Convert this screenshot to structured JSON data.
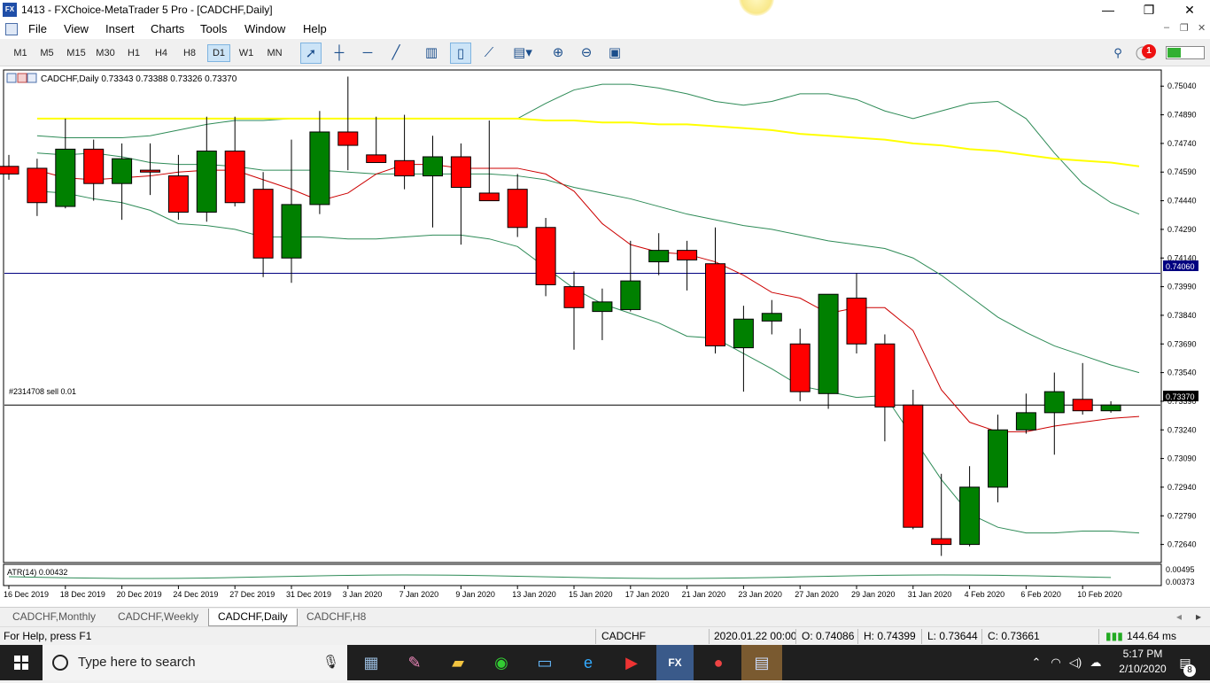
{
  "window": {
    "title": "1413 - FXChoice-MetaTrader 5 Pro - [CADCHF,Daily]",
    "logo_text": "FX",
    "minimize": "—",
    "maximize": "❐",
    "close": "✕"
  },
  "menu": {
    "items": [
      "File",
      "View",
      "Insert",
      "Charts",
      "Tools",
      "Window",
      "Help"
    ],
    "mdi": [
      "–",
      "❐",
      "✕"
    ]
  },
  "toolbar": {
    "timeframes": [
      "M1",
      "M5",
      "M15",
      "M30",
      "H1",
      "H4",
      "H8",
      "D1",
      "W1",
      "MN"
    ],
    "active_timeframe": "D1",
    "notifications": "1",
    "signal_level": 0.35,
    "colors": {
      "signal": "#33b033",
      "badge": "#ee1111"
    }
  },
  "chart": {
    "header": "CADCHF,Daily  0.73343 0.73388 0.73326 0.73370",
    "order_label": "#2314708 sell 0.01",
    "indicator_label": "ATR(14) 0.00432",
    "indicator_levels": [
      "0.00495",
      "0.00373"
    ],
    "horizontal_line_price": "0.74060",
    "current_price": "0.73370",
    "colors": {
      "bull": "#008000",
      "bear": "#ff0000",
      "ma_slow": "#ffff00",
      "ma_fast": "#cc0000",
      "bands": "#2e8b57",
      "hline": "#000080"
    }
  },
  "chart_data": {
    "type": "candlestick",
    "symbol": "CADCHF",
    "timeframe": "Daily",
    "ylim": [
      0.7255,
      0.7512
    ],
    "y_ticks": [
      "0.75040",
      "0.74890",
      "0.74740",
      "0.74590",
      "0.74440",
      "0.74290",
      "0.74140",
      "0.73990",
      "0.73840",
      "0.73690",
      "0.73540",
      "0.73390",
      "0.73240",
      "0.73090",
      "0.72940",
      "0.72790",
      "0.72640"
    ],
    "x_labels": [
      "16 Dec 2019",
      "18 Dec 2019",
      "20 Dec 2019",
      "24 Dec 2019",
      "27 Dec 2019",
      "31 Dec 2019",
      "3 Jan 2020",
      "7 Jan 2020",
      "9 Jan 2020",
      "13 Jan 2020",
      "15 Jan 2020",
      "17 Jan 2020",
      "21 Jan 2020",
      "23 Jan 2020",
      "27 Jan 2020",
      "29 Jan 2020",
      "31 Jan 2020",
      "4 Feb 2020",
      "6 Feb 2020",
      "10 Feb 2020"
    ],
    "candles": [
      {
        "o": 0.7462,
        "h": 0.7468,
        "l": 0.7455,
        "c": 0.7458
      },
      {
        "o": 0.7461,
        "h": 0.7466,
        "l": 0.7436,
        "c": 0.7443
      },
      {
        "o": 0.7441,
        "h": 0.7487,
        "l": 0.744,
        "c": 0.7471
      },
      {
        "o": 0.7471,
        "h": 0.7476,
        "l": 0.7444,
        "c": 0.7453
      },
      {
        "o": 0.7453,
        "h": 0.7474,
        "l": 0.7434,
        "c": 0.7466
      },
      {
        "o": 0.746,
        "h": 0.7474,
        "l": 0.7447,
        "c": 0.7459
      },
      {
        "o": 0.7457,
        "h": 0.7468,
        "l": 0.7434,
        "c": 0.7438
      },
      {
        "o": 0.7438,
        "h": 0.7488,
        "l": 0.7433,
        "c": 0.747
      },
      {
        "o": 0.747,
        "h": 0.7488,
        "l": 0.7441,
        "c": 0.7443
      },
      {
        "o": 0.745,
        "h": 0.7459,
        "l": 0.7404,
        "c": 0.7414
      },
      {
        "o": 0.7414,
        "h": 0.7476,
        "l": 0.7401,
        "c": 0.7442
      },
      {
        "o": 0.7442,
        "h": 0.7491,
        "l": 0.7437,
        "c": 0.748
      },
      {
        "o": 0.748,
        "h": 0.7509,
        "l": 0.746,
        "c": 0.7473
      },
      {
        "o": 0.7468,
        "h": 0.7488,
        "l": 0.7464,
        "c": 0.7464
      },
      {
        "o": 0.7465,
        "h": 0.7489,
        "l": 0.745,
        "c": 0.7457
      },
      {
        "o": 0.7457,
        "h": 0.7478,
        "l": 0.743,
        "c": 0.7467
      },
      {
        "o": 0.7467,
        "h": 0.7474,
        "l": 0.7421,
        "c": 0.7451
      },
      {
        "o": 0.7448,
        "h": 0.7486,
        "l": 0.7447,
        "c": 0.7444
      },
      {
        "o": 0.745,
        "h": 0.7458,
        "l": 0.7425,
        "c": 0.743
      },
      {
        "o": 0.743,
        "h": 0.7435,
        "l": 0.7394,
        "c": 0.74
      },
      {
        "o": 0.7399,
        "h": 0.7407,
        "l": 0.7366,
        "c": 0.7388
      },
      {
        "o": 0.7386,
        "h": 0.7398,
        "l": 0.7371,
        "c": 0.7391
      },
      {
        "o": 0.7387,
        "h": 0.7423,
        "l": 0.7386,
        "c": 0.7402
      },
      {
        "o": 0.7412,
        "h": 0.7427,
        "l": 0.7405,
        "c": 0.7418
      },
      {
        "o": 0.7418,
        "h": 0.7423,
        "l": 0.7397,
        "c": 0.7413
      },
      {
        "o": 0.7411,
        "h": 0.743,
        "l": 0.7364,
        "c": 0.7368
      },
      {
        "o": 0.7367,
        "h": 0.7389,
        "l": 0.7344,
        "c": 0.7382
      },
      {
        "o": 0.7381,
        "h": 0.7392,
        "l": 0.7374,
        "c": 0.7385
      },
      {
        "o": 0.7369,
        "h": 0.7377,
        "l": 0.7339,
        "c": 0.7344
      },
      {
        "o": 0.7343,
        "h": 0.7395,
        "l": 0.7335,
        "c": 0.7395
      },
      {
        "o": 0.7393,
        "h": 0.7406,
        "l": 0.7364,
        "c": 0.7369
      },
      {
        "o": 0.7369,
        "h": 0.7374,
        "l": 0.7318,
        "c": 0.7336
      },
      {
        "o": 0.7337,
        "h": 0.7345,
        "l": 0.7272,
        "c": 0.7273
      },
      {
        "o": 0.7267,
        "h": 0.7301,
        "l": 0.7258,
        "c": 0.7264
      },
      {
        "o": 0.7264,
        "h": 0.7305,
        "l": 0.7263,
        "c": 0.7294
      },
      {
        "o": 0.7294,
        "h": 0.7332,
        "l": 0.7286,
        "c": 0.7324
      },
      {
        "o": 0.7324,
        "h": 0.7343,
        "l": 0.7322,
        "c": 0.7333
      },
      {
        "o": 0.7333,
        "h": 0.7354,
        "l": 0.7311,
        "c": 0.7344
      },
      {
        "o": 0.734,
        "h": 0.7359,
        "l": 0.7332,
        "c": 0.7334
      },
      {
        "o": 0.7334,
        "h": 0.7339,
        "l": 0.7333,
        "c": 0.7337
      }
    ],
    "ma_slow": [
      0.7487,
      0.7487,
      0.7487,
      0.7487,
      0.7487,
      0.7487,
      0.7487,
      0.7487,
      0.7487,
      0.7487,
      0.7487,
      0.7487,
      0.7487,
      0.7487,
      0.7487,
      0.7487,
      0.7487,
      0.7487,
      0.7486,
      0.7486,
      0.7485,
      0.7485,
      0.7484,
      0.7484,
      0.7483,
      0.7482,
      0.7481,
      0.7479,
      0.7478,
      0.7477,
      0.7476,
      0.7474,
      0.7473,
      0.7471,
      0.747,
      0.7468,
      0.7466,
      0.7465,
      0.7464,
      0.7462
    ],
    "ma_fast": [
      0.746,
      0.7456,
      0.7455,
      0.7456,
      0.7457,
      0.7459,
      0.746,
      0.746,
      0.7455,
      0.745,
      0.7444,
      0.7448,
      0.7458,
      0.7463,
      0.7463,
      0.7461,
      0.7461,
      0.7461,
      0.7458,
      0.7449,
      0.7432,
      0.7421,
      0.7417,
      0.7416,
      0.7412,
      0.7405,
      0.7396,
      0.7393,
      0.7385,
      0.7388,
      0.7388,
      0.7376,
      0.7345,
      0.7328,
      0.7323,
      0.7323,
      0.7326,
      0.7328,
      0.733,
      0.7331
    ],
    "band_upper": [
      0.7478,
      0.7477,
      0.7477,
      0.7477,
      0.7478,
      0.7481,
      0.7484,
      0.7486,
      0.7486,
      0.7487,
      0.7487,
      0.7487,
      0.7487,
      0.7487,
      0.7487,
      0.7487,
      0.7487,
      0.7487,
      0.7495,
      0.7502,
      0.7505,
      0.7505,
      0.7503,
      0.75,
      0.7496,
      0.7494,
      0.7496,
      0.75,
      0.75,
      0.7497,
      0.7491,
      0.7487,
      0.7491,
      0.7495,
      0.7496,
      0.7487,
      0.7469,
      0.7453,
      0.7443,
      0.7437
    ],
    "band_mid": [
      0.7469,
      0.7468,
      0.7469,
      0.7467,
      0.7464,
      0.7463,
      0.7463,
      0.7462,
      0.746,
      0.746,
      0.746,
      0.7459,
      0.7458,
      0.7458,
      0.7458,
      0.7458,
      0.7458,
      0.7457,
      0.7455,
      0.7451,
      0.7448,
      0.7445,
      0.7441,
      0.7437,
      0.7434,
      0.7431,
      0.7429,
      0.7426,
      0.7423,
      0.7421,
      0.7419,
      0.7414,
      0.7405,
      0.7394,
      0.7383,
      0.7375,
      0.7368,
      0.7363,
      0.7358,
      0.7354
    ],
    "band_lower": [
      0.7449,
      0.7448,
      0.7445,
      0.7443,
      0.7439,
      0.7432,
      0.7431,
      0.7429,
      0.7425,
      0.7425,
      0.7425,
      0.7424,
      0.7424,
      0.7425,
      0.7426,
      0.7426,
      0.7424,
      0.742,
      0.7409,
      0.7398,
      0.739,
      0.7385,
      0.738,
      0.7373,
      0.7372,
      0.7364,
      0.7356,
      0.7347,
      0.7344,
      0.7341,
      0.7342,
      0.732,
      0.7298,
      0.728,
      0.7273,
      0.727,
      0.727,
      0.7271,
      0.7271,
      0.727
    ],
    "atr_level": 0.00432
  },
  "tabs": [
    "CADCHF,Monthly",
    "CADCHF,Weekly",
    "CADCHF,Daily",
    "CADCHF,H8"
  ],
  "active_tab": "CADCHF,Daily",
  "status": {
    "help": "For Help, press F1",
    "symbol": "CADCHF",
    "datetime": "2020.01.22 00:00",
    "open": "O: 0.74086",
    "high": "H: 0.74399",
    "low": "L: 0.73644",
    "close": "C: 0.73661",
    "ping": "144.64 ms"
  },
  "taskbar": {
    "search_placeholder": "Type here to search",
    "time": "5:17 PM",
    "date": "2/10/2020",
    "notification_count": "8",
    "apps": [
      "file-explorer",
      "paint",
      "folder",
      "whatsapp",
      "remote-desktop",
      "internet-explorer",
      "media",
      "fxchoice",
      "chrome",
      "terminal"
    ]
  }
}
